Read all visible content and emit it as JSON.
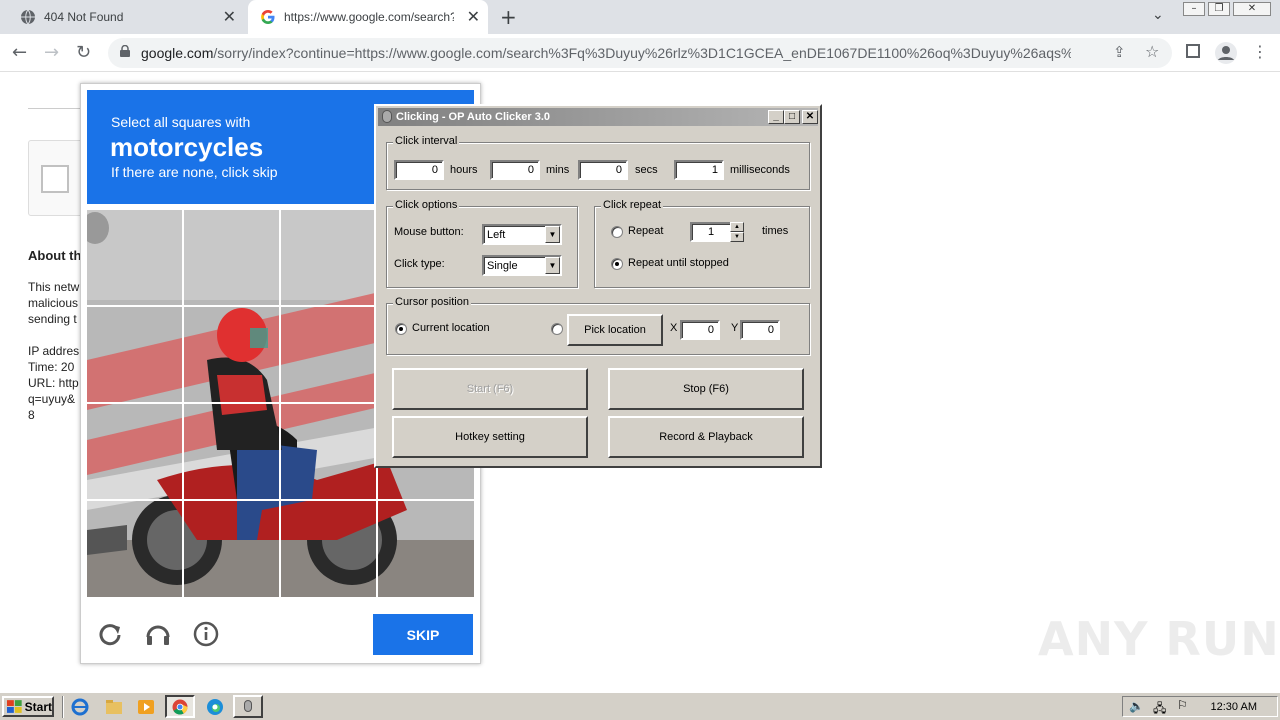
{
  "browser": {
    "tabs": [
      {
        "title": "404 Not Found",
        "icon": "globe-icon"
      },
      {
        "title": "https://www.google.com/search?q=",
        "icon": "google-icon"
      }
    ],
    "address": {
      "domain": "google.com",
      "rest": "/sorry/index?continue=https://www.google.com/search%3Fq%3Duyuy%26rlz%3D1C1GCEA_enDE1067DE1100%26oq%3Duyuy%26aqs%..."
    }
  },
  "page": {
    "heading": "About th",
    "lines": [
      "This netw",
      "malicious",
      "sending t"
    ],
    "info": [
      "IP addres",
      "Time: 20",
      "URL: http",
      "q=uyuy&",
      "8"
    ]
  },
  "captcha": {
    "line1": "Select all squares with",
    "target": "motorcycles",
    "line3": "If there are none, click skip",
    "skip_label": "SKIP",
    "brand_color": "#1a73e8"
  },
  "clicker": {
    "title": "Clicking - OP Auto Clicker 3.0",
    "interval": {
      "label": "Click interval",
      "hours": "0",
      "hours_label": "hours",
      "mins": "0",
      "mins_label": "mins",
      "secs": "0",
      "secs_label": "secs",
      "ms": "1",
      "ms_label": "milliseconds"
    },
    "options": {
      "label": "Click options",
      "mouse_button_label": "Mouse button:",
      "mouse_button": "Left",
      "click_type_label": "Click type:",
      "click_type": "Single"
    },
    "repeat": {
      "label": "Click repeat",
      "repeat_label": "Repeat",
      "repeat_count": "1",
      "times_label": "times",
      "until_stopped_label": "Repeat until stopped",
      "selected": "until_stopped"
    },
    "cursor": {
      "label": "Cursor position",
      "current_label": "Current location",
      "pick_label": "Pick location",
      "x_label": "X",
      "x": "0",
      "y_label": "Y",
      "y": "0",
      "selected": "current"
    },
    "buttons": {
      "start": "Start (F6)",
      "stop": "Stop (F6)",
      "hotkey": "Hotkey setting",
      "record": "Record & Playback"
    }
  },
  "watermark": "ANY RUN",
  "taskbar": {
    "start_label": "Start",
    "clock": "12:30 AM"
  }
}
